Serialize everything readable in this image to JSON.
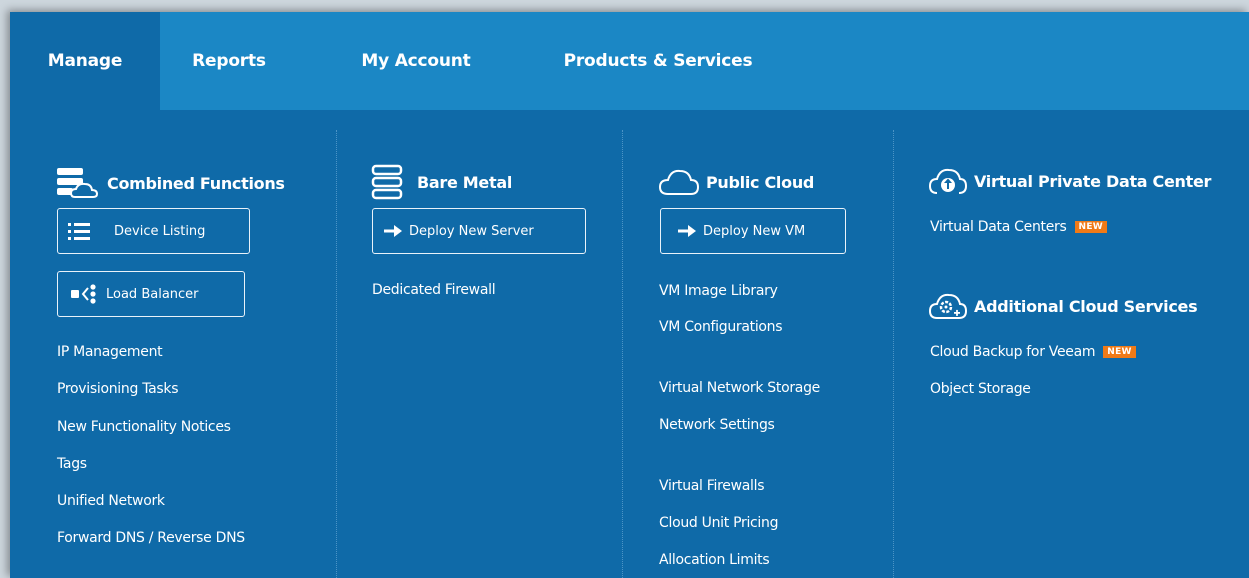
{
  "nav": {
    "tabs": [
      {
        "label": "Manage",
        "active": true
      },
      {
        "label": "Reports"
      },
      {
        "label": "My Account"
      },
      {
        "label": "Products & Services"
      }
    ]
  },
  "combined": {
    "title": "Combined Functions",
    "device_listing": "Device Listing",
    "load_balancer": "Load Balancer",
    "links": [
      "IP Management",
      "Provisioning Tasks",
      "New Functionality Notices",
      "Tags",
      "Unified Network",
      "Forward DNS / Reverse DNS"
    ]
  },
  "bare_metal": {
    "title": "Bare Metal",
    "deploy": "Deploy New Server",
    "links": [
      "Dedicated Firewall"
    ]
  },
  "public_cloud": {
    "title": "Public Cloud",
    "deploy": "Deploy New VM",
    "links": [
      "VM Image Library",
      "VM Configurations",
      "Virtual Network Storage",
      "Network Settings",
      "Virtual Firewalls",
      "Cloud Unit Pricing",
      "Allocation Limits"
    ]
  },
  "vpdc": {
    "title": "Virtual Private Data Center",
    "link": "Virtual Data Centers",
    "badge": "NEW"
  },
  "additional": {
    "title": "Additional Cloud Services",
    "link_backup": "Cloud Backup for Veeam",
    "badge": "NEW",
    "link_object": "Object Storage"
  },
  "colors": {
    "panel": "#0f6aa8",
    "nav_bar": "#1b87c5",
    "badge": "#f07a17"
  }
}
